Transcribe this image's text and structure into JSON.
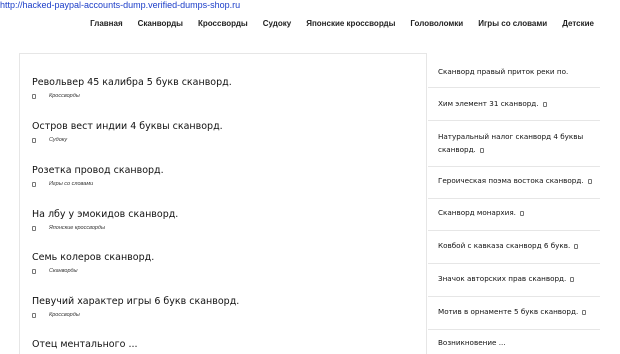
{
  "url_text": "http://hacked-paypal-accounts-dump.verified-dumps-shop.ru",
  "nav": [
    "Главная",
    "Сканворды",
    "Кроссворды",
    "Судоку",
    "Японские кроссворды",
    "Головоломки",
    "Игры со словами",
    "Детские"
  ],
  "posts": [
    {
      "title": "Револьвер 45 калибра 5 букв сканворд.",
      "category": "Кроссворды"
    },
    {
      "title": "Остров вест индии 4 буквы сканворд.",
      "category": "Судоку"
    },
    {
      "title": "Розетка провод сканворд.",
      "category": "Игры со словами"
    },
    {
      "title": "На лбу у эмокидов сканворд.",
      "category": "Японские кроссворды"
    },
    {
      "title": "Семь колеров сканворд.",
      "category": "Сканворды"
    },
    {
      "title": "Певучий характер игры 6 букв сканворд.",
      "category": "Кроссворды"
    },
    {
      "title": "Отец ментального ...",
      "category": ""
    }
  ],
  "sidebar": [
    "Сканворд правый приток реки по.",
    "Хим элемент 31 сканворд.",
    "Натуральный налог сканворд 4 буквы сканворд.",
    "Героическая поэма востока сканворд.",
    "Сканворд монархия.",
    "Ковбой с кавказа сканворд 6 букв.",
    "Значок авторских прав сканворд.",
    "Мотив в орнаменте 5 букв сканворд.",
    "Возникновение ..."
  ],
  "icons": {
    "meta": "calendar-icon",
    "sidebar": "calendar-icon"
  }
}
